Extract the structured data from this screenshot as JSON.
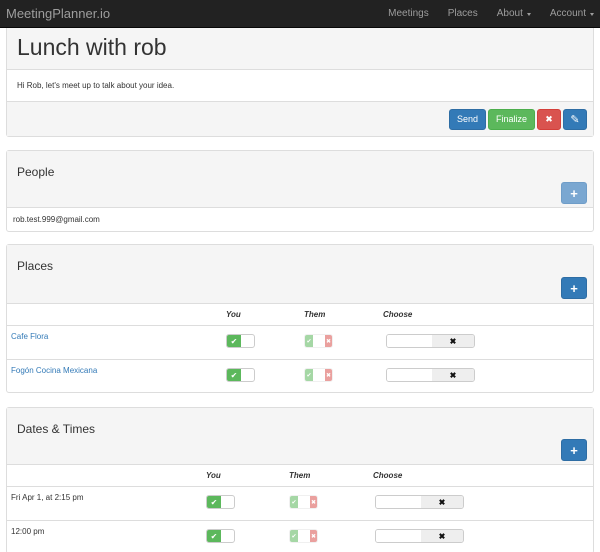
{
  "navbar": {
    "brand": "MeetingPlanner.io",
    "links": [
      {
        "label": "Meetings",
        "dropdown": false
      },
      {
        "label": "Places",
        "dropdown": false
      },
      {
        "label": "About",
        "dropdown": true
      },
      {
        "label": "Account",
        "dropdown": true
      }
    ]
  },
  "meeting": {
    "title": "Lunch with rob",
    "message": "Hi Rob, let's meet up to talk about your idea.",
    "buttons": {
      "send": "Send",
      "finalize": "Finalize",
      "cancel_icon": "✖",
      "edit_icon": "✎"
    }
  },
  "people": {
    "title": "People",
    "add_icon": "+",
    "items": [
      "rob.test.999@gmail.com"
    ]
  },
  "places": {
    "title": "Places",
    "add_icon": "+",
    "columns": {
      "you": "You",
      "them": "Them",
      "choose": "Choose"
    },
    "rows": [
      {
        "name": "Cafe Flora",
        "you": "yes",
        "them": "undecided",
        "chosen": false
      },
      {
        "name": "Fogón Cocina Mexicana",
        "you": "yes",
        "them": "undecided",
        "chosen": false
      }
    ]
  },
  "dates": {
    "title": "Dates & Times",
    "add_icon": "+",
    "columns": {
      "you": "You",
      "them": "Them",
      "choose": "Choose"
    },
    "rows": [
      {
        "label": "Fri Apr 1, at 2:15 pm",
        "you": "yes",
        "them": "undecided",
        "chosen": false
      },
      {
        "label": "12:00 pm",
        "you": "yes",
        "them": "undecided",
        "chosen": false
      }
    ]
  },
  "icons": {
    "check": "✔",
    "cross": "✖"
  },
  "colors": {
    "navbar_bg": "#222222",
    "primary": "#337ab7",
    "success": "#5cb85c",
    "danger": "#d9534f",
    "link": "#337ab7"
  }
}
